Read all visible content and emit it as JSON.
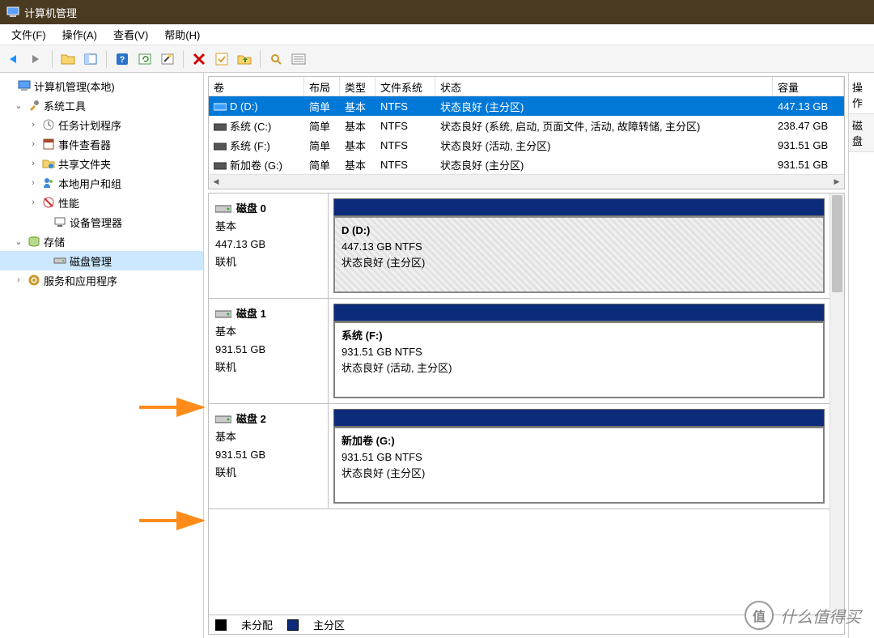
{
  "window": {
    "title": "计算机管理"
  },
  "menu": {
    "file": "文件(F)",
    "action": "操作(A)",
    "view": "查看(V)",
    "help": "帮助(H)"
  },
  "tree": {
    "root": "计算机管理(本地)",
    "systools": "系统工具",
    "taskscheduler": "任务计划程序",
    "eventviewer": "事件查看器",
    "sharedfolders": "共享文件夹",
    "localusers": "本地用户和组",
    "performance": "性能",
    "devicemgr": "设备管理器",
    "storage": "存储",
    "diskmgmt": "磁盘管理",
    "services": "服务和应用程序"
  },
  "volTable": {
    "headers": {
      "volume": "卷",
      "layout": "布局",
      "type": "类型",
      "filesystem": "文件系统",
      "status": "状态",
      "capacity": "容量"
    },
    "rows": [
      {
        "name": "D (D:)",
        "layout": "简单",
        "type": "基本",
        "fs": "NTFS",
        "status": "状态良好 (主分区)",
        "capacity": "447.13 GB",
        "selected": true,
        "iconColor": "#3aa0ff"
      },
      {
        "name": "系统 (C:)",
        "layout": "简单",
        "type": "基本",
        "fs": "NTFS",
        "status": "状态良好 (系统, 启动, 页面文件, 活动, 故障转储, 主分区)",
        "capacity": "238.47 GB",
        "selected": false,
        "iconColor": "#555"
      },
      {
        "name": "系统 (F:)",
        "layout": "简单",
        "type": "基本",
        "fs": "NTFS",
        "status": "状态良好 (活动, 主分区)",
        "capacity": "931.51 GB",
        "selected": false,
        "iconColor": "#555"
      },
      {
        "name": "新加卷 (G:)",
        "layout": "简单",
        "type": "基本",
        "fs": "NTFS",
        "status": "状态良好 (主分区)",
        "capacity": "931.51 GB",
        "selected": false,
        "iconColor": "#555"
      }
    ]
  },
  "disks": [
    {
      "name": "磁盘 0",
      "type": "基本",
      "size": "447.13 GB",
      "state": "联机",
      "vol": {
        "title": "D  (D:)",
        "size": "447.13 GB NTFS",
        "status": "状态良好 (主分区)"
      },
      "hatched": true
    },
    {
      "name": "磁盘 1",
      "type": "基本",
      "size": "931.51 GB",
      "state": "联机",
      "vol": {
        "title": "系统  (F:)",
        "size": "931.51 GB NTFS",
        "status": "状态良好 (活动, 主分区)"
      },
      "hatched": false
    },
    {
      "name": "磁盘 2",
      "type": "基本",
      "size": "931.51 GB",
      "state": "联机",
      "vol": {
        "title": "新加卷  (G:)",
        "size": "931.51 GB NTFS",
        "status": "状态良好 (主分区)"
      },
      "hatched": false
    }
  ],
  "legend": {
    "unallocated": "未分配",
    "primary": "主分区"
  },
  "actions": {
    "header": "操作",
    "row": "磁盘"
  },
  "watermark": {
    "label": "值",
    "text": "什么值得买"
  }
}
